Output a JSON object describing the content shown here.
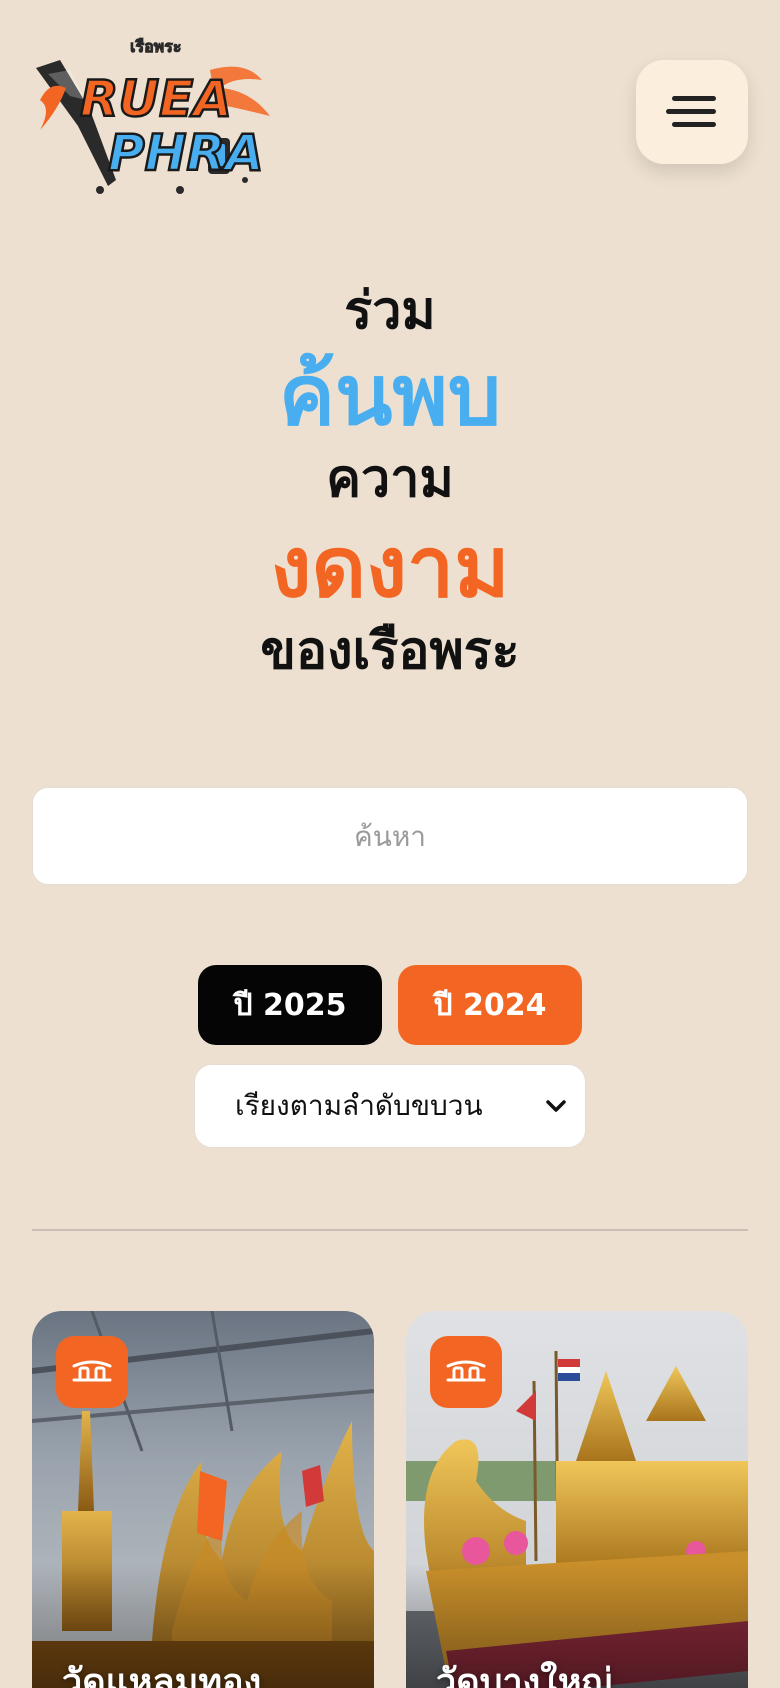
{
  "header": {
    "logo": {
      "small_text": "เรือพระ",
      "line1": "RUEA",
      "line2": "PHRA"
    },
    "menu_icon": "hamburger-icon"
  },
  "hero": {
    "line1": "ร่วม",
    "line2": "ค้นพบ",
    "line3": "ความ",
    "line4": "งดงาม",
    "line5": "ของเรือพระ",
    "colors": {
      "dark": "#111111",
      "blue": "#48aef0",
      "orange": "#f26522"
    }
  },
  "search": {
    "placeholder": "ค้นหา",
    "value": ""
  },
  "filters": {
    "years": [
      {
        "label": "ปี 2025",
        "style": "dark"
      },
      {
        "label": "ปี 2024",
        "style": "orange"
      }
    ],
    "sort": {
      "selected": "เรียงตามลำดับขบวน",
      "icon": "chevron-down-icon"
    }
  },
  "cards": [
    {
      "title": "วัดแหลมทอง",
      "badge_icon": "boat-icon"
    },
    {
      "title": "วัดบางใหญ่",
      "badge_icon": "boat-icon"
    }
  ],
  "colors": {
    "background": "#ede0d0",
    "menu_bg": "#fbeedd",
    "accent": "#f26522",
    "dark_button": "#050505"
  }
}
